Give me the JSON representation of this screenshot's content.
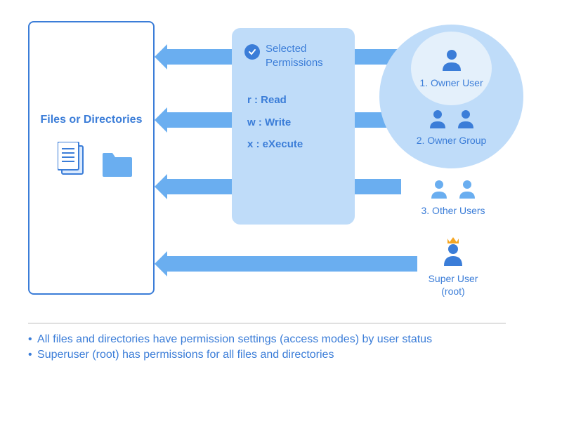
{
  "files": {
    "title": "Files or Directories"
  },
  "permissions": {
    "title": "Selected Permissions",
    "items": {
      "r": "r : Read",
      "w": "w : Write",
      "x": "x : eXecute"
    }
  },
  "users": {
    "owner": "1. Owner User",
    "group": "2. Owner Group",
    "other": "3. Other Users",
    "super": "Super User",
    "super_sub": "(root)"
  },
  "bullets": {
    "b1": "All files and directories have permission settings (access modes) by user status",
    "b2": "Superuser (root) has permissions for all files and directories"
  }
}
